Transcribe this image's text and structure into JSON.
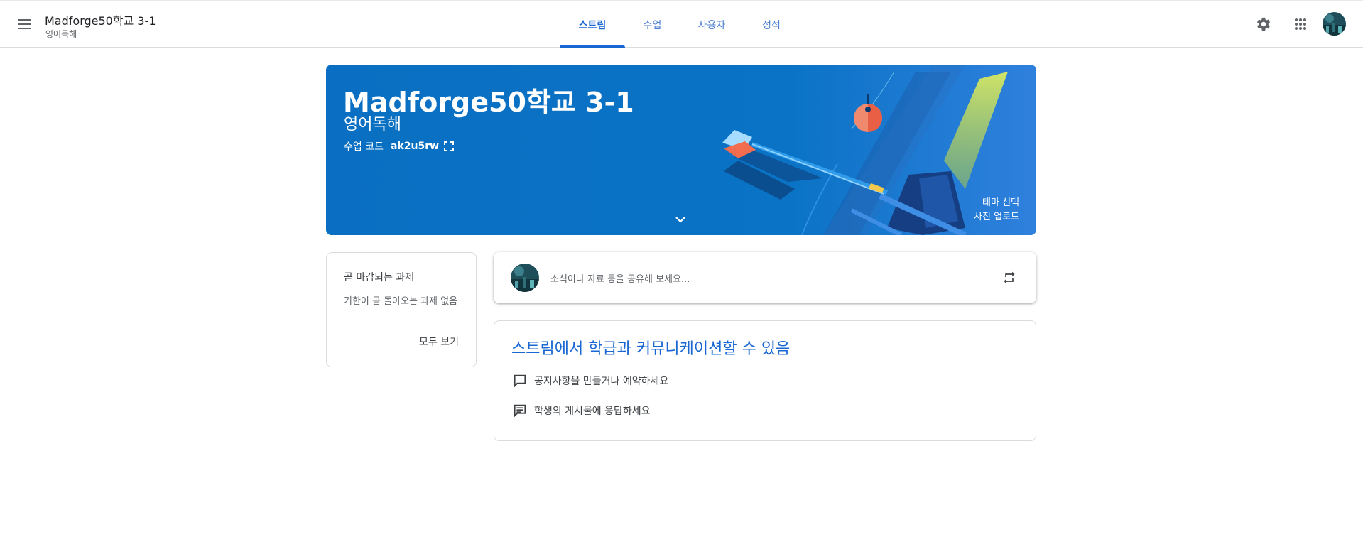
{
  "header": {
    "class_name": "Madforge50학교 3-1",
    "section": "영어독해",
    "tabs": [
      {
        "label": "스트림",
        "active": true
      },
      {
        "label": "수업",
        "active": false
      },
      {
        "label": "사용자",
        "active": false
      },
      {
        "label": "성적",
        "active": false
      }
    ],
    "icons": [
      "menu-icon",
      "gear-icon",
      "apps-grid-icon",
      "avatar"
    ]
  },
  "banner": {
    "title": "Madforge50학교 3-1",
    "subtitle": "영어독해",
    "code_label": "수업 코드",
    "code_value": "ak2u5rw",
    "select_theme": "테마 선택",
    "upload_photo": "사진 업로드",
    "background_color": "#0a73c5"
  },
  "upcoming": {
    "title": "곧 마감되는 과제",
    "empty_text": "기한이 곧 돌아오는 과제 없음",
    "view_all": "모두 보기"
  },
  "share": {
    "placeholder": "소식이나 자료 등을 공유해 보세요..."
  },
  "info": {
    "title": "스트림에서 학급과 커뮤니케이션할 수 있음",
    "items": [
      {
        "icon": "announcement-icon",
        "text": "공지사항을 만들거나 예약하세요"
      },
      {
        "icon": "comment-icon",
        "text": "학생의 게시물에 응답하세요"
      }
    ]
  },
  "colors": {
    "accent": "#1967d2",
    "banner": "#0a73c5",
    "text": "#3c4043"
  }
}
